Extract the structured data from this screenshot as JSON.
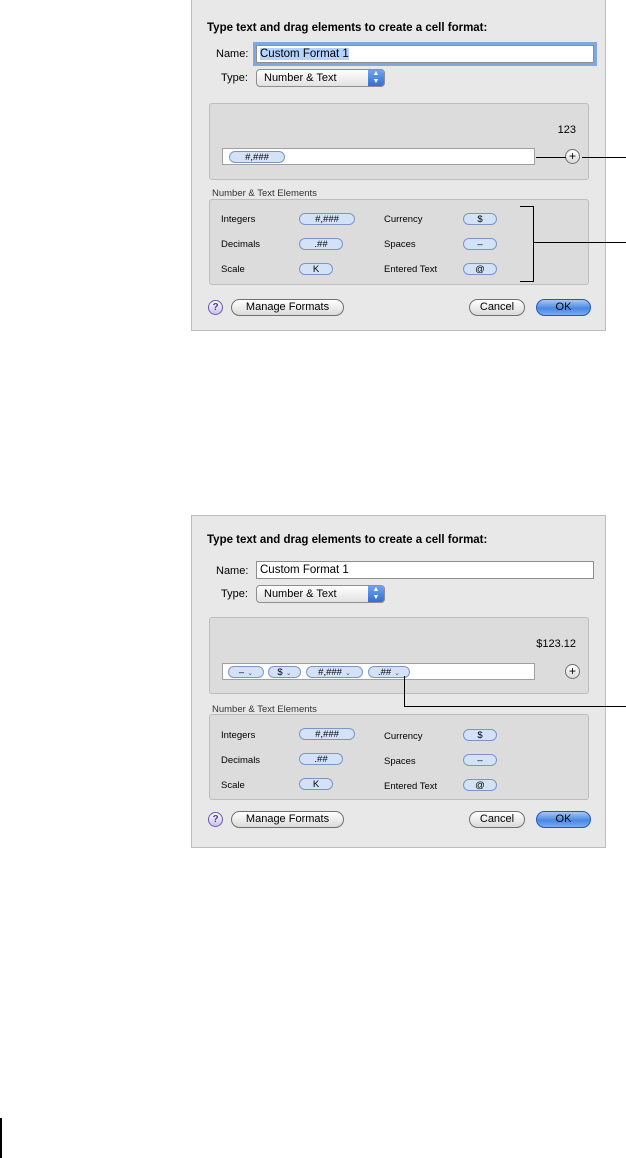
{
  "dialogs": [
    {
      "heading": "Type text and drag elements to create a cell format:",
      "name_label": "Name:",
      "name_value": "Custom Format 1",
      "type_label": "Type:",
      "type_value": "Number & Text",
      "preview_value": "123",
      "format_tokens": [
        "#,###"
      ],
      "plus_label": "+",
      "elements_title": "Number & Text Elements",
      "elements": {
        "integers_label": "Integers",
        "integers_token": "#,###",
        "currency_label": "Currency",
        "currency_token": "$",
        "decimals_label": "Decimals",
        "decimals_token": ".##",
        "spaces_label": "Spaces",
        "spaces_token": "–",
        "scale_label": "Scale",
        "scale_token": "K",
        "entered_text_label": "Entered Text",
        "entered_text_token": "@"
      },
      "help_label": "?",
      "manage_label": "Manage Formats",
      "cancel_label": "Cancel",
      "ok_label": "OK"
    },
    {
      "heading": "Type text and drag elements to create a cell format:",
      "name_label": "Name:",
      "name_value": "Custom Format 1",
      "type_label": "Type:",
      "type_value": "Number & Text",
      "preview_value": "$123.12",
      "format_tokens": [
        "–",
        "$",
        "#,###",
        ".##"
      ],
      "plus_label": "+",
      "elements_title": "Number & Text Elements",
      "elements": {
        "integers_label": "Integers",
        "integers_token": "#,###",
        "currency_label": "Currency",
        "currency_token": "$",
        "decimals_label": "Decimals",
        "decimals_token": ".##",
        "spaces_label": "Spaces",
        "spaces_token": "–",
        "scale_label": "Scale",
        "scale_token": "K",
        "entered_text_label": "Entered Text",
        "entered_text_token": "@"
      },
      "help_label": "?",
      "manage_label": "Manage Formats",
      "cancel_label": "Cancel",
      "ok_label": "OK"
    }
  ],
  "icons": {
    "popup_arrows": "up-down-arrows-icon",
    "chevron": "chevron-down-icon"
  }
}
